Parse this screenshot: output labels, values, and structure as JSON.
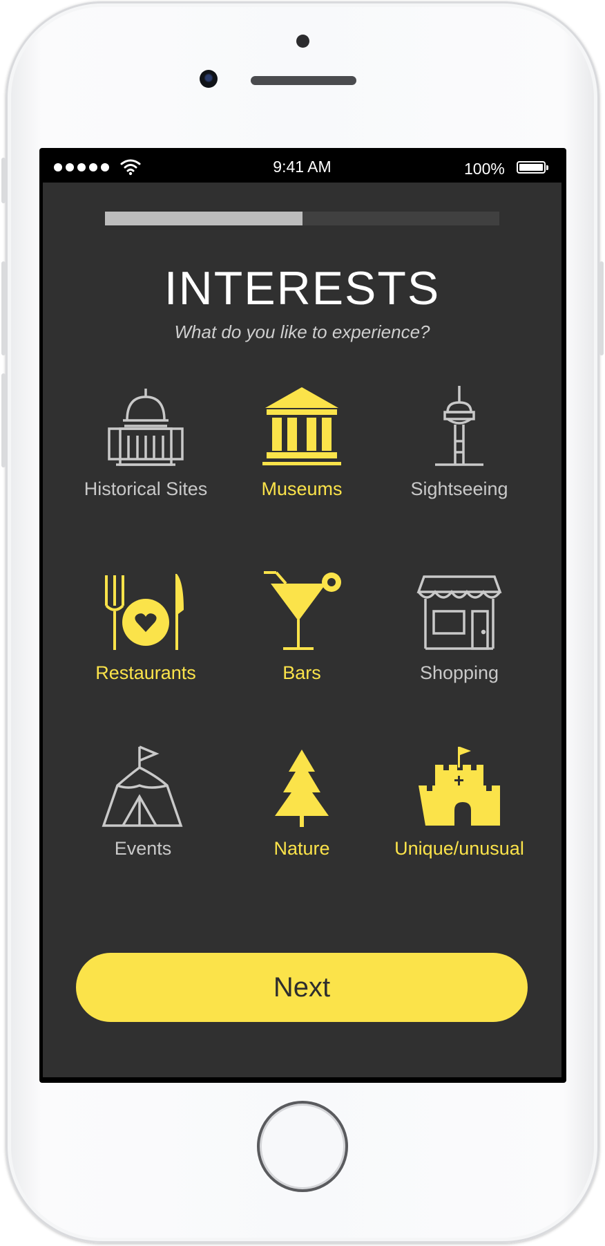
{
  "status_bar": {
    "time": "9:41 AM",
    "battery": "100%",
    "icons": [
      "signal-dots-icon",
      "wifi-icon",
      "battery-icon"
    ]
  },
  "progress": {
    "fraction": 0.5
  },
  "header": {
    "title": "INTERESTS",
    "subtitle": "What do you like to experience?"
  },
  "interests": [
    {
      "label": "Historical Sites",
      "icon": "capitol-building-icon",
      "selected": false
    },
    {
      "label": "Museums",
      "icon": "museum-icon",
      "selected": true
    },
    {
      "label": "Sightseeing",
      "icon": "observation-tower-icon",
      "selected": false
    },
    {
      "label": "Restaurants",
      "icon": "fork-plate-knife-icon",
      "selected": true
    },
    {
      "label": "Bars",
      "icon": "cocktail-glass-icon",
      "selected": true
    },
    {
      "label": "Shopping",
      "icon": "storefront-icon",
      "selected": false
    },
    {
      "label": "Events",
      "icon": "tent-icon",
      "selected": false
    },
    {
      "label": "Nature",
      "icon": "pine-tree-icon",
      "selected": true
    },
    {
      "label": "Unique/unusual",
      "icon": "castle-icon",
      "selected": true
    }
  ],
  "next_button": {
    "label": "Next"
  },
  "colors": {
    "accent": "#fbe34a",
    "background": "#303030",
    "unselected": "#c9c9c9",
    "progress_fill": "#bdbdbd",
    "progress_track": "#404040"
  }
}
